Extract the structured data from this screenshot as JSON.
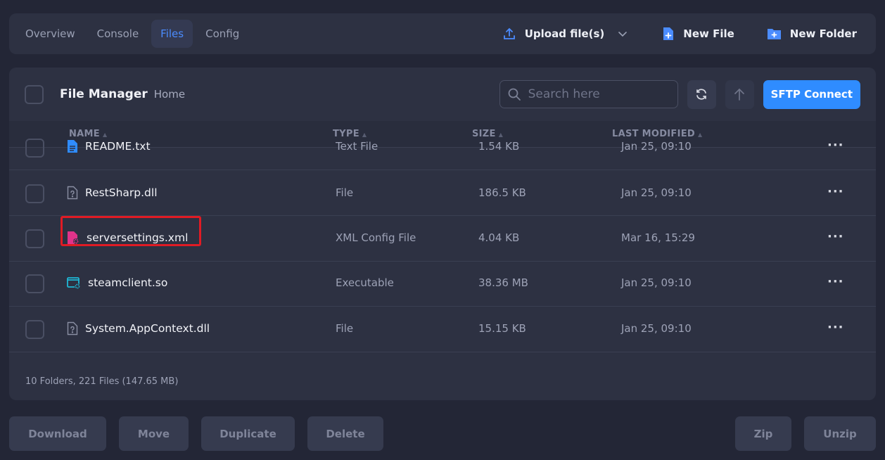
{
  "nav": {
    "tabs": [
      {
        "label": "Overview"
      },
      {
        "label": "Console"
      },
      {
        "label": "Files"
      },
      {
        "label": "Config"
      }
    ],
    "actions": {
      "upload": "Upload file(s)",
      "new_file": "New File",
      "new_folder": "New Folder"
    }
  },
  "panel": {
    "title": "File Manager",
    "breadcrumb": "Home",
    "search_placeholder": "Search here",
    "sftp_label": "SFTP Connect",
    "columns": {
      "name": "NAME",
      "type": "TYPE",
      "size": "SIZE",
      "modified": "LAST MODIFIED"
    },
    "rows": [
      {
        "name": "README.txt",
        "type": "Text File",
        "size": "1.54 KB",
        "modified": "Jan 25, 09:10",
        "icon": "text-file-icon",
        "icon_color": "#2f8cff"
      },
      {
        "name": "RestSharp.dll",
        "type": "File",
        "size": "186.5 KB",
        "modified": "Jan 25, 09:10",
        "icon": "unknown-file-icon",
        "icon_color": "#8a8fa3"
      },
      {
        "name": "serversettings.xml",
        "type": "XML Config File",
        "size": "4.04 KB",
        "modified": "Mar 16, 15:29",
        "icon": "config-file-icon",
        "icon_color": "#e0338a"
      },
      {
        "name": "steamclient.so",
        "type": "Executable",
        "size": "38.36 MB",
        "modified": "Jan 25, 09:10",
        "icon": "executable-icon",
        "icon_color": "#1fb8d6"
      },
      {
        "name": "System.AppContext.dll",
        "type": "File",
        "size": "15.15 KB",
        "modified": "Jan 25, 09:10",
        "icon": "unknown-file-icon",
        "icon_color": "#8a8fa3"
      }
    ],
    "row_menu": "···",
    "summary": "10 Folders, 221 Files (147.65 MB)"
  },
  "bottom_actions": {
    "download": "Download",
    "move": "Move",
    "duplicate": "Duplicate",
    "delete": "Delete",
    "zip": "Zip",
    "unzip": "Unzip"
  },
  "colors": {
    "accent": "#2f8cff",
    "highlight_box": "#e01b24"
  }
}
